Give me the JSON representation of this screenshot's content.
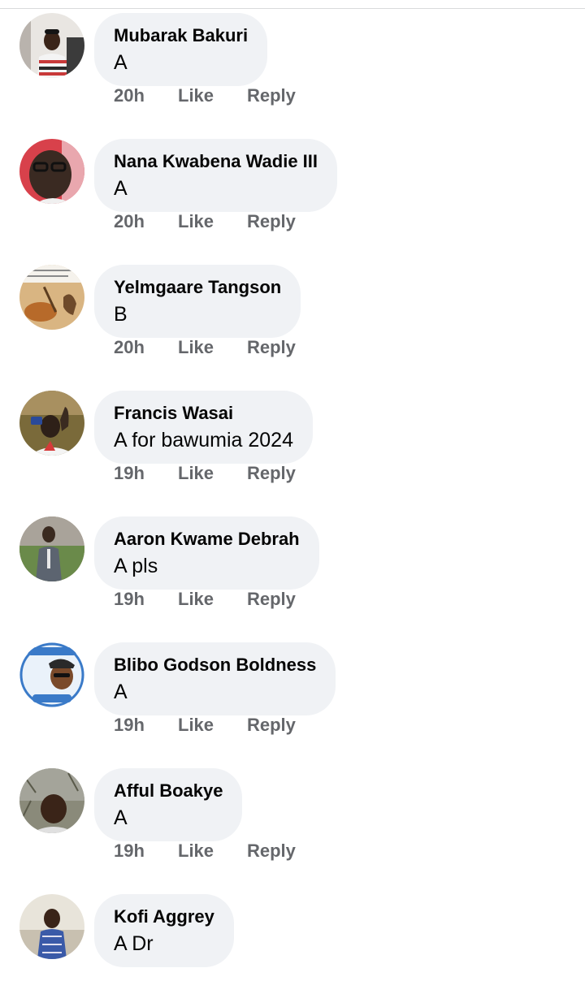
{
  "actions": {
    "like_label": "Like",
    "reply_label": "Reply"
  },
  "comments": [
    {
      "author": "Mubarak Bakuri",
      "text": "A",
      "time": "20h"
    },
    {
      "author": "Nana Kwabena Wadie III",
      "text": "A",
      "time": "20h"
    },
    {
      "author": "Yelmgaare Tangson",
      "text": "B",
      "time": "20h"
    },
    {
      "author": "Francis Wasai",
      "text": "A for bawumia 2024",
      "time": "19h"
    },
    {
      "author": "Aaron Kwame Debrah",
      "text": "A pls",
      "time": "19h"
    },
    {
      "author": "Blibo Godson Boldness",
      "text": "A",
      "time": "19h"
    },
    {
      "author": "Afful Boakye",
      "text": "A",
      "time": "19h"
    },
    {
      "author": "Kofi Aggrey",
      "text": "A Dr",
      "time": ""
    }
  ],
  "colors": {
    "bubble": "#f0f2f5",
    "meta": "#65676b",
    "text": "#050505"
  }
}
